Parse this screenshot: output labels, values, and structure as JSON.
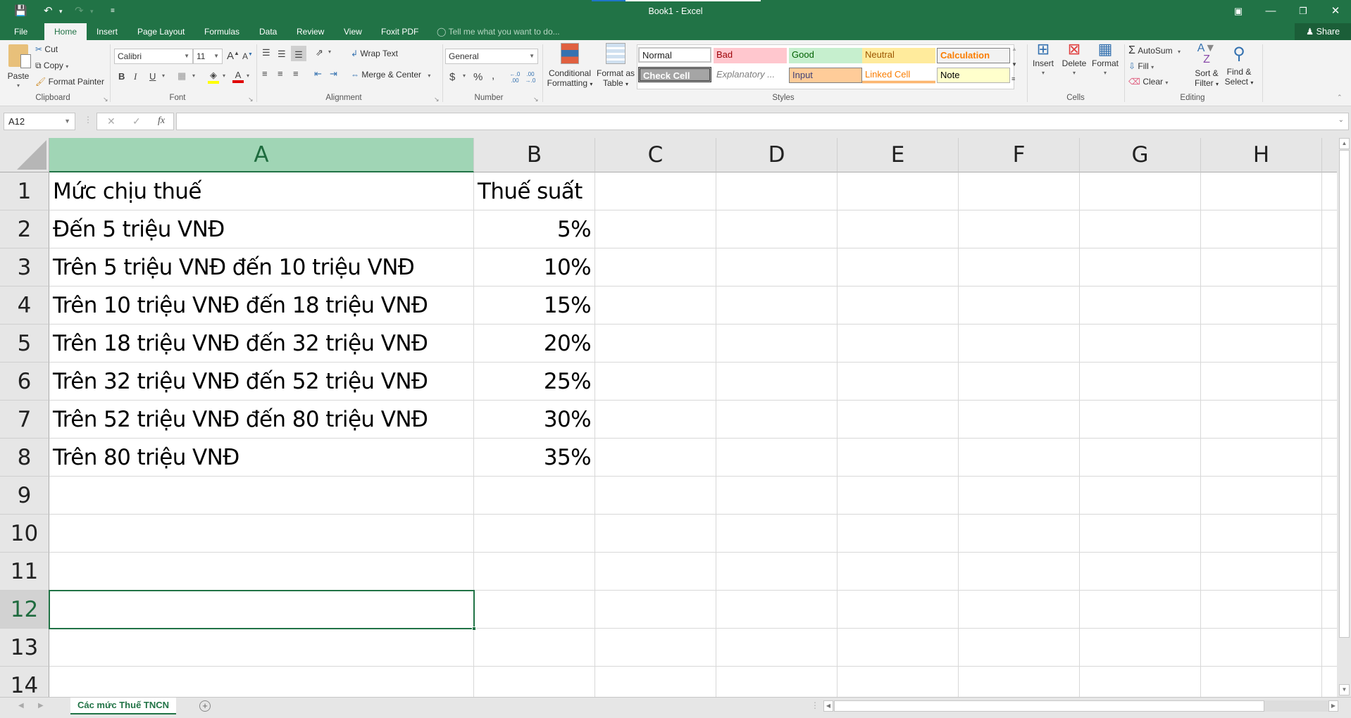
{
  "titlebar": {
    "title": "Book1 - Excel",
    "quick_access": {
      "save_icon": "save-icon",
      "undo_icon": "undo-icon",
      "redo_icon": "redo-icon",
      "customize_icon": "customize-qat-icon"
    },
    "window_buttons": {
      "ribbon_display": "ribbon-display-options-icon",
      "minimize": "minimize-icon",
      "restore": "restore-icon",
      "close": "close-icon"
    }
  },
  "ribbon_tabs": [
    "File",
    "Home",
    "Insert",
    "Page Layout",
    "Formulas",
    "Data",
    "Review",
    "View",
    "Foxit PDF"
  ],
  "active_tab": "Home",
  "tell_me": "Tell me what you want to do...",
  "share_label": "Share",
  "ribbon": {
    "clipboard": {
      "label": "Clipboard",
      "paste": "Paste",
      "cut": "Cut",
      "copy": "Copy",
      "format_painter": "Format Painter"
    },
    "font": {
      "label": "Font",
      "font_name": "Calibri",
      "font_size": "11",
      "bold": "B",
      "italic": "I",
      "underline": "U",
      "grow": "A",
      "shrink": "A",
      "font_color": "A",
      "highlight_color": "#ffff00",
      "text_color": "#e00000"
    },
    "alignment": {
      "label": "Alignment",
      "wrap_text": "Wrap Text",
      "merge_center": "Merge & Center"
    },
    "number": {
      "label": "Number",
      "format": "General",
      "currency": "$",
      "percent": "%",
      "comma": ",",
      "inc_decimal": "←.0 .00",
      "dec_decimal": ".00 →.0"
    },
    "styles": {
      "label": "Styles",
      "conditional_formatting": [
        "Conditional",
        "Formatting"
      ],
      "format_as_table": [
        "Format as",
        "Table"
      ],
      "cells": [
        {
          "name": "Normal",
          "bg": "#ffffff",
          "fg": "#000000"
        },
        {
          "name": "Bad",
          "bg": "#ffc7ce",
          "fg": "#9c0006"
        },
        {
          "name": "Good",
          "bg": "#c6efce",
          "fg": "#006100"
        },
        {
          "name": "Neutral",
          "bg": "#ffeb9c",
          "fg": "#9c5700"
        },
        {
          "name": "Calculation",
          "bg": "#f2f2f2",
          "fg": "#fa7d00"
        },
        {
          "name": "Check Cell",
          "bg": "#a5a5a5",
          "fg": "#ffffff"
        },
        {
          "name": "Explanatory ...",
          "bg": "#ffffff",
          "fg": "#7f7f7f"
        },
        {
          "name": "Input",
          "bg": "#ffcc99",
          "fg": "#3f3f76"
        },
        {
          "name": "Linked Cell",
          "bg": "#ffffff",
          "fg": "#fa7d00"
        },
        {
          "name": "Note",
          "bg": "#ffffcc",
          "fg": "#000000"
        }
      ]
    },
    "cells": {
      "label": "Cells",
      "insert": "Insert",
      "delete": "Delete",
      "format": "Format"
    },
    "editing": {
      "label": "Editing",
      "autosum": "AutoSum",
      "fill": "Fill",
      "clear": "Clear",
      "sort_filter": [
        "Sort &",
        "Filter"
      ],
      "find_select": [
        "Find &",
        "Select"
      ]
    }
  },
  "formula_bar": {
    "name_box": "A12",
    "cancel": "✕",
    "enter": "✓",
    "fx": "fx",
    "content": ""
  },
  "grid": {
    "columns": [
      "A",
      "B",
      "C",
      "D",
      "E",
      "F",
      "G",
      "H"
    ],
    "selected_column": "A",
    "rows": [
      "1",
      "2",
      "3",
      "4",
      "5",
      "6",
      "7",
      "8",
      "9",
      "10",
      "11",
      "12",
      "13",
      "14"
    ],
    "selected_row": "12",
    "selected_cell": "A12",
    "data": [
      [
        "Mức chịu thuế",
        "Thuế suất"
      ],
      [
        "Đến 5 triệu VNĐ",
        "5%"
      ],
      [
        "Trên 5 triệu VNĐ đến 10 triệu VNĐ",
        "10%"
      ],
      [
        "Trên 10 triệu VNĐ đến 18 triệu VNĐ",
        "15%"
      ],
      [
        "Trên 18 triệu VNĐ đến 32 triệu VNĐ",
        "20%"
      ],
      [
        "Trên 32 triệu VNĐ đến 52 triệu VNĐ",
        "25%"
      ],
      [
        "Trên 52 triệu VNĐ đến 80 triệu VNĐ",
        "30%"
      ],
      [
        "Trên 80 triệu VNĐ",
        "35%"
      ]
    ]
  },
  "sheets": {
    "tabs": [
      "Các mức Thuế TNCN"
    ],
    "active": "Các mức Thuế TNCN",
    "add_label": "+"
  },
  "colors": {
    "brand": "#217346",
    "header_selected": "#a0d5b5"
  }
}
